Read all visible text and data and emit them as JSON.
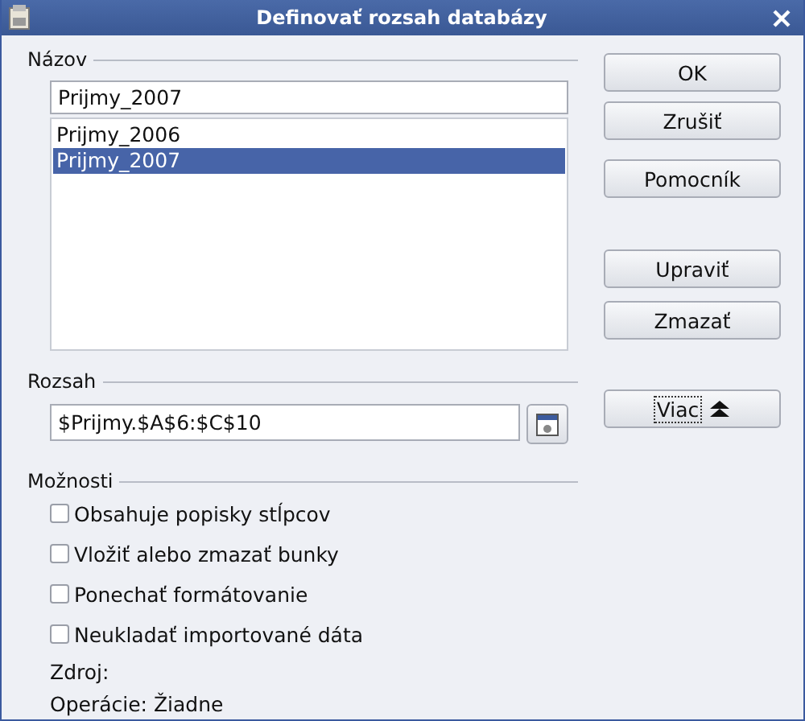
{
  "window": {
    "title": "Definovať rozsah databázy"
  },
  "name_section": {
    "label": "Názov",
    "value": "Prijmy_2007",
    "items": [
      {
        "label": "Prijmy_2006",
        "selected": false
      },
      {
        "label": "Prijmy_2007",
        "selected": true
      }
    ]
  },
  "range_section": {
    "label": "Rozsah",
    "value": "$Prijmy.$A$6:$C$10"
  },
  "options_section": {
    "label": "Možnosti",
    "options": [
      {
        "label": "Obsahuje popisky stĺpcov",
        "checked": false
      },
      {
        "label": "Vložiť alebo zmazať bunky",
        "checked": false
      },
      {
        "label": "Ponechať formátovanie",
        "checked": false
      },
      {
        "label": "Neukladať importované dáta",
        "checked": false
      }
    ],
    "source": "Zdroj:",
    "operations": "Operácie: Žiadne"
  },
  "button_groups": [
    [
      "OK",
      "Zrušiť"
    ],
    [
      "Pomocník"
    ],
    [
      "Upraviť",
      "Zmazať"
    ]
  ],
  "more_button": {
    "label": "Viac"
  }
}
